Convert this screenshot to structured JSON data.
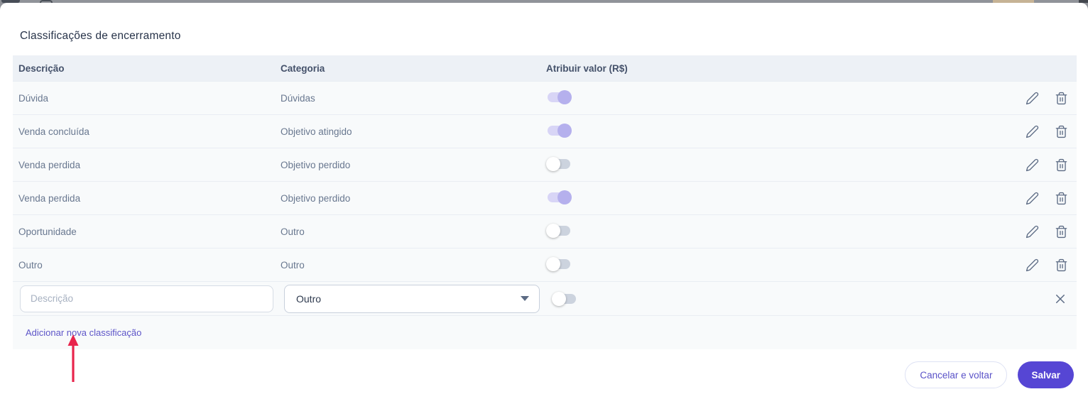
{
  "modal": {
    "title": "Classificações de encerramento"
  },
  "table": {
    "columns": [
      "Descrição",
      "Categoria",
      "Atribuir valor (R$)"
    ],
    "rows": [
      {
        "descricao": "Dúvida",
        "categoria": "Dúvidas",
        "atribuir_valor": true
      },
      {
        "descricao": "Venda concluída",
        "categoria": "Objetivo atingido",
        "atribuir_valor": true
      },
      {
        "descricao": "Venda perdida",
        "categoria": "Objetivo perdido",
        "atribuir_valor": false
      },
      {
        "descricao": "Venda perdida",
        "categoria": "Objetivo perdido",
        "atribuir_valor": true
      },
      {
        "descricao": "Oportunidade",
        "categoria": "Outro",
        "atribuir_valor": false
      },
      {
        "descricao": "Outro",
        "categoria": "Outro",
        "atribuir_valor": false
      }
    ]
  },
  "new_row": {
    "descricao_placeholder": "Descrição",
    "descricao_value": "",
    "categoria_selected": "Outro",
    "atribuir_valor": false
  },
  "add_link": {
    "label": "Adicionar nova classificação"
  },
  "footer": {
    "cancel_label": "Cancelar e voltar",
    "save_label": "Salvar"
  },
  "icons": {
    "edit": "pencil-icon",
    "delete": "trash-icon",
    "close": "x-icon",
    "dropdown": "chevron-down-icon"
  },
  "annotation": {
    "type": "red-arrow-up",
    "color": "#e8244c",
    "points_to": "Adicionar nova classificação"
  },
  "colors": {
    "accent_purple": "#5646d4",
    "link_purple": "#5d55c8",
    "toggle_on_thumb": "#b5b0ed",
    "toggle_on_track": "#d8d5f6",
    "toggle_off_track": "#ccd3de",
    "row_bg": "#f8fafb",
    "header_bg": "#edf1f6",
    "icon_slate": "#5c6b84"
  }
}
